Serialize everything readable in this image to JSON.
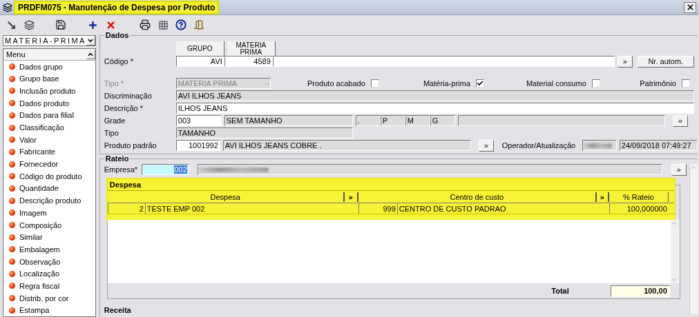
{
  "window": {
    "title": "PRDFM075 - Manutenção de Despesa por Produto",
    "highlighted": true
  },
  "sidebar": {
    "selector": "MATERIA-PRIMA",
    "menu_title": "Menu",
    "items": [
      "Dados grupo",
      "Grupo base",
      "Inclusão produto",
      "Dados produto",
      "Dados para filial",
      "Classificação",
      "Valor",
      "Fabricante",
      "Fornecedor",
      "Código do produto",
      "Quantidade",
      "Descrição produto",
      "Imagem",
      "Composição",
      "Similar",
      "Embalagem",
      "Observação",
      "Localização",
      "Regra fiscal",
      "Distrib. por cor",
      "Estampa"
    ]
  },
  "dados": {
    "title": "Dados",
    "codigo": {
      "label": "Código *",
      "columns": [
        "GRUPO",
        "MATERIA PRIMA"
      ],
      "values": [
        "AVI",
        "4589"
      ],
      "lookup": "»",
      "auto_button": "Nr. autom."
    },
    "tipo": {
      "label": "Tipo *",
      "value": "MATERIA PRIMA",
      "disabled": true
    },
    "flags": [
      {
        "label": "Produto acabado",
        "checked": false
      },
      {
        "label": "Matéria-prima",
        "checked": true
      },
      {
        "label": "Material consumo",
        "checked": false
      },
      {
        "label": "Patrimônio",
        "checked": false
      }
    ],
    "discriminacao": {
      "label": "Discriminação",
      "value": "AVI ILHOS JEANS"
    },
    "descricao": {
      "label": "Descrição *",
      "value": "ILHOS JEANS"
    },
    "grade": {
      "label": "Grade",
      "code": "003",
      "name": "SEM TAMANHO",
      "sizes": [
        ".",
        "P",
        "M",
        "G"
      ],
      "lookup": "»"
    },
    "tipo_grade": {
      "label": "Tipo",
      "value": "TAMANHO"
    },
    "produto_padrao": {
      "label": "Produto padrão",
      "code": "1001992",
      "name": "AVI ILHOS JEANS COBRE .",
      "lookup": "»"
    },
    "operador": {
      "label": "Operador/Atualização",
      "date": "24/09/2018 07:49:27"
    }
  },
  "rateio": {
    "title": "Rateio",
    "empresa": {
      "label": "Empresa*",
      "value": "002",
      "value_selected": true,
      "lookup": "»"
    },
    "despesa": {
      "title": "Despesa",
      "highlighted": true,
      "columns": [
        {
          "kind": "text",
          "label": "Despesa"
        },
        {
          "kind": "lookup",
          "label": "»"
        },
        {
          "kind": "text",
          "label": "Centro de custo"
        },
        {
          "kind": "lookup",
          "label": "»"
        },
        {
          "kind": "text",
          "label": "% Rateio"
        }
      ],
      "rows": [
        {
          "despesa_code": "2",
          "despesa": "TESTE EMP 002",
          "centro_code": "999",
          "centro": "CENTRO DE CUSTO PADRAO",
          "rateio": "100,000000"
        }
      ],
      "total_label": "Total",
      "total": "100,00"
    }
  },
  "receita": {
    "title": "Receita"
  }
}
